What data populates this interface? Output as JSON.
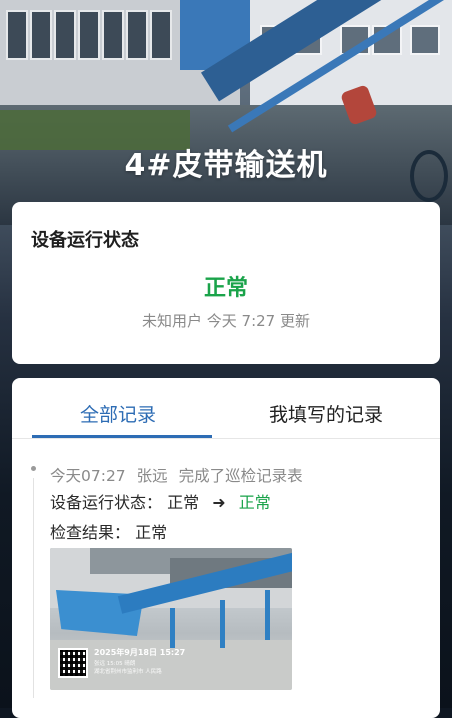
{
  "page": {
    "title": "4#皮带输送机"
  },
  "status_card": {
    "heading": "设备运行状态",
    "value": "正常",
    "value_color": "#1aa34a",
    "updated_by": "未知用户",
    "updated_at": "今天 7:27",
    "updated_suffix": "更新"
  },
  "records": {
    "tabs": [
      {
        "label": "全部记录",
        "active": true
      },
      {
        "label": "我填写的记录",
        "active": false
      }
    ],
    "accent_color": "#2d6cb4",
    "entries": [
      {
        "time": "今天07:27",
        "user": "张远",
        "action": "完成了巡检记录表",
        "status_label": "设备运行状态：",
        "status_from": "正常",
        "status_arrow_icon": "arrow-right-icon",
        "status_to": "正常",
        "result_label": "检查结果：",
        "result_value": "正常",
        "photo": {
          "timestamp": "2025年9月18日 15:27",
          "line1": "张远 15:05  晴朗",
          "line2": "湖北省荆州市监利市 人民路"
        }
      }
    ]
  }
}
